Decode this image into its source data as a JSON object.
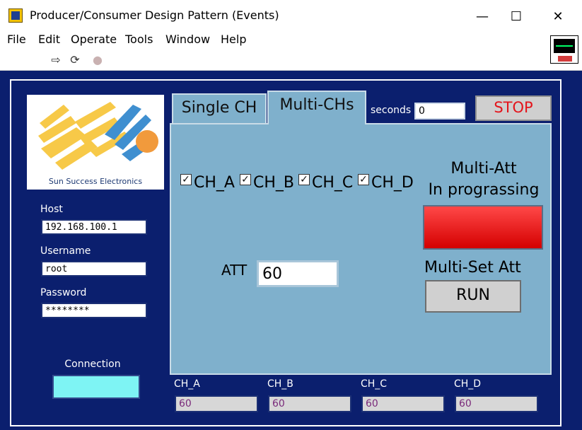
{
  "window": {
    "title": "Producer/Consumer Design Pattern (Events)",
    "minimize": "—",
    "maximize": "☐",
    "close": "✕"
  },
  "menu": {
    "items": [
      "File",
      "Edit",
      "Operate",
      "Tools",
      "Window",
      "Help"
    ]
  },
  "toolbar": {
    "run_icon": "⇨",
    "run_continuous_icon": "⟳",
    "abort_icon": "●"
  },
  "logo": {
    "text": "Sun Success Electronics",
    "colors": {
      "yellow": "#f7c948",
      "blue": "#3f8fd0",
      "orange": "#f19a3c"
    }
  },
  "connection": {
    "host_label": "Host",
    "host_value": "192.168.100.1",
    "username_label": "Username",
    "username_value": "root",
    "password_label": "Password",
    "password_value": "********",
    "indicator_label": "Connection"
  },
  "tabs": [
    {
      "label": "Single CH"
    },
    {
      "label": "Multi-CHs"
    }
  ],
  "seconds": {
    "label": "seconds",
    "value": "0"
  },
  "stop": {
    "label": "STOP"
  },
  "multi": {
    "channels": [
      {
        "label": "CH_A",
        "checked": true,
        "mark": "✓"
      },
      {
        "label": "CH_B",
        "checked": true,
        "mark": "✓"
      },
      {
        "label": "CH_C",
        "checked": true,
        "mark": "✓"
      },
      {
        "label": "CH_D",
        "checked": true,
        "mark": "✓"
      }
    ],
    "att_label": "ATT",
    "att_value": "60",
    "status_line1": "Multi-Att",
    "status_line2": "In prograssing",
    "set_label": "Multi-Set Att",
    "run_label": "RUN"
  },
  "indicators": [
    {
      "label": "CH_A",
      "value": "60"
    },
    {
      "label": "CH_B",
      "value": "60"
    },
    {
      "label": "CH_C",
      "value": "60"
    },
    {
      "label": "CH_D",
      "value": "60"
    }
  ]
}
